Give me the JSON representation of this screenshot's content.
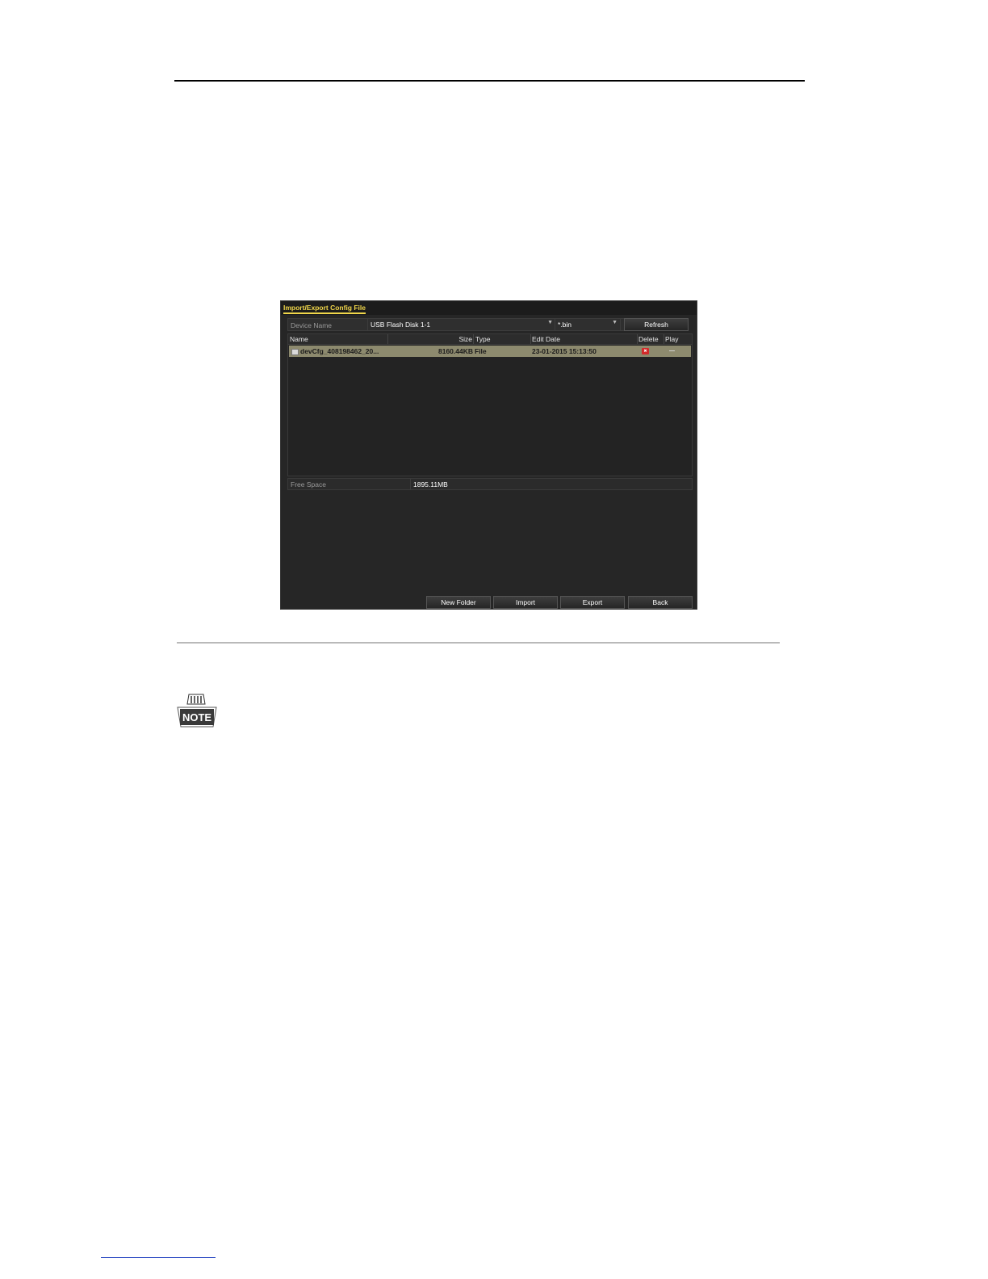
{
  "window": {
    "title": "Import/Export Config File"
  },
  "device": {
    "label": "Device Name",
    "value": "USB Flash Disk 1-1",
    "filter": "*.bin",
    "refresh_label": "Refresh"
  },
  "table": {
    "columns": [
      "Name",
      "Size",
      "Type",
      "Edit Date",
      "Delete",
      "Play"
    ],
    "rows": [
      {
        "name": "devCfg_408198462_20...",
        "size": "8160.44KB",
        "type": "File",
        "edit_date": "23-01-2015 15:13:50",
        "delete_icon": "delete-icon",
        "play": "—"
      }
    ]
  },
  "free_space": {
    "label": "Free Space",
    "value": "1895.11MB"
  },
  "buttons": {
    "new_folder": "New Folder",
    "import": "Import",
    "export": "Export",
    "back": "Back"
  },
  "note": {
    "icon": "note-icon",
    "label": "NOTE"
  },
  "colors": {
    "title_accent": "#f0d64a",
    "selected_row": "#8d8a6e",
    "delete_red": "#d22b2b",
    "panel_bg": "#262626"
  }
}
